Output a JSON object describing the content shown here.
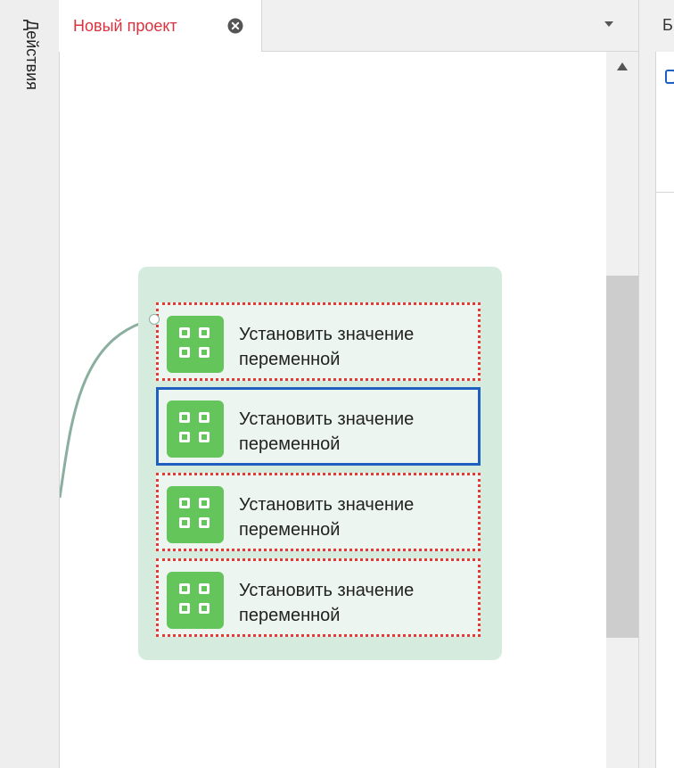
{
  "left_rail": {
    "tab_label": "Действия"
  },
  "tabs": [
    {
      "label": "Новый проект",
      "active": true
    }
  ],
  "right_panel": {
    "tab_label": "Бр"
  },
  "canvas": {
    "group": {
      "actions": [
        {
          "label": "Установить значение переменной",
          "selected": false
        },
        {
          "label": "Установить значение переменной",
          "selected": true
        },
        {
          "label": "Установить значение переменной",
          "selected": false
        },
        {
          "label": "Установить значение переменной",
          "selected": false
        }
      ]
    }
  },
  "colors": {
    "tab_title": "#d9333f",
    "group_bg": "#d4ebdd",
    "action_bg": "#ecf5ef",
    "action_border": "#e53935",
    "selected_border": "#1e5fbf",
    "icon_bg": "#63c55a",
    "connector": "#8aaf9f"
  },
  "icons": {
    "action": "grid-icon",
    "tab_close": "close-circle-icon",
    "tab_menu": "chevron-down-icon",
    "scroll_up": "arrow-up-icon"
  }
}
